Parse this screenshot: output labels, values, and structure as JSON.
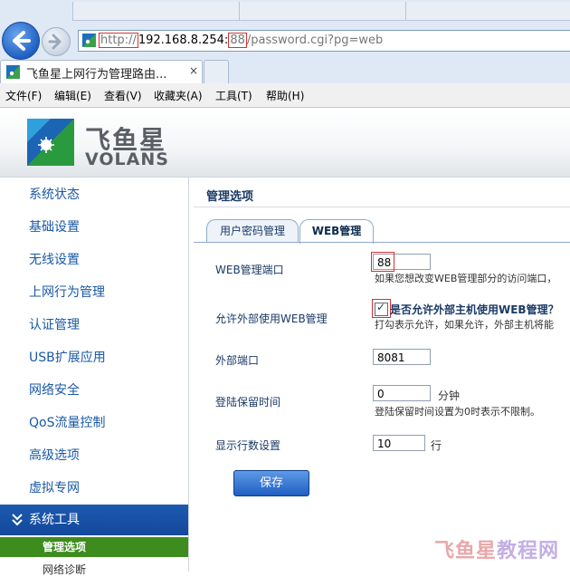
{
  "browser": {
    "address": {
      "scheme": "http://",
      "host": "192.168.8.254:",
      "port": "88",
      "path": "/password.cgi?pg=web"
    },
    "tab_title": "飞鱼星上网行为管理路由...",
    "tab_close": "×",
    "menu": [
      "文件(F)",
      "编辑(E)",
      "查看(V)",
      "收藏夹(A)",
      "工具(T)",
      "帮助(H)"
    ]
  },
  "header": {
    "logo_cn": "飞鱼星",
    "logo_en": "VOLANS"
  },
  "sidebar": {
    "items": [
      "系统状态",
      "基础设置",
      "无线设置",
      "上网行为管理",
      "认证管理",
      "USB扩展应用",
      "网络安全",
      "QoS流量控制",
      "高级选项",
      "虚拟专网"
    ],
    "section_icon": "double-chevron-down-icon",
    "section": "系统工具",
    "sub_active": "管理选项",
    "sub_next": "网络诊断"
  },
  "content": {
    "title": "管理选项",
    "tabs": [
      "用户密码管理",
      "WEB管理"
    ],
    "fields": {
      "web_port": {
        "label": "WEB管理端口",
        "value": "88",
        "hint": "如果您想改变WEB管理部分的访问端口，"
      },
      "remote": {
        "label": "允许外部使用WEB管理",
        "check_label": "是否允许外部主机使用WEB管理？",
        "hint": "打勾表示允许，如果允许，外部主机将能"
      },
      "ext_port": {
        "label": "外部端口",
        "value": "8081"
      },
      "timeout": {
        "label": "登陆保留时间",
        "value": "0",
        "unit": "分钟",
        "hint": "登陆保留时间设置为0时表示不限制。"
      },
      "rows": {
        "label": "显示行数设置",
        "value": "10",
        "unit": "行"
      }
    },
    "save_label": "保存"
  },
  "watermark": {
    "part1": "飞鱼星",
    "part2": "教程网"
  }
}
